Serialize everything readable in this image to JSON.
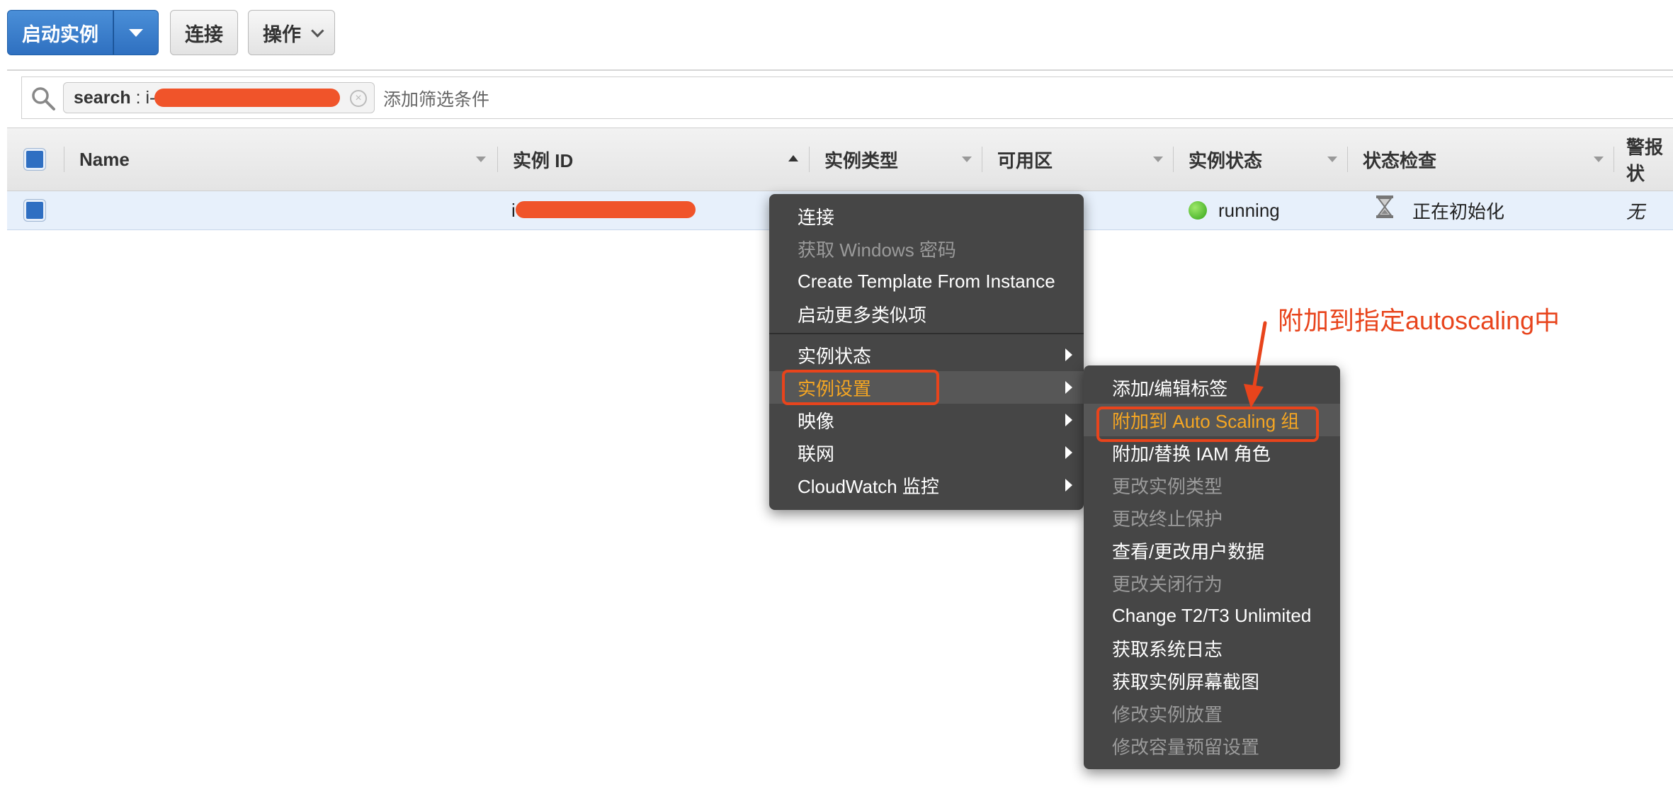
{
  "toolbar": {
    "launch_label": "启动实例",
    "connect_label": "连接",
    "actions_label": "操作"
  },
  "search": {
    "chip_key": "search",
    "chip_sep": " : ",
    "chip_value_prefix": "i-",
    "placeholder": "添加筛选条件"
  },
  "table": {
    "columns": [
      "Name",
      "实例 ID",
      "实例类型",
      "可用区",
      "实例状态",
      "状态检查",
      "警报状"
    ],
    "row": {
      "name": "",
      "instance_id_prefix": "i-",
      "state": "running",
      "status_check": "正在初始化",
      "alarm": "无"
    }
  },
  "context_menu": {
    "items": [
      {
        "label": "连接",
        "enabled": true
      },
      {
        "label": "获取 Windows 密码",
        "enabled": false
      },
      {
        "label": "Create Template From Instance",
        "enabled": true
      },
      {
        "label": "启动更多类似项",
        "enabled": true
      },
      {
        "label": "实例状态",
        "enabled": true,
        "submenu": true
      },
      {
        "label": "实例设置",
        "enabled": true,
        "submenu": true,
        "selected": true
      },
      {
        "label": "映像",
        "enabled": true,
        "submenu": true
      },
      {
        "label": "联网",
        "enabled": true,
        "submenu": true
      },
      {
        "label": "CloudWatch 监控",
        "enabled": true,
        "submenu": true
      }
    ]
  },
  "submenu": {
    "items": [
      {
        "label": "添加/编辑标签",
        "enabled": true
      },
      {
        "label": "附加到 Auto Scaling 组",
        "enabled": true,
        "selected": true
      },
      {
        "label": "附加/替换 IAM 角色",
        "enabled": true
      },
      {
        "label": "更改实例类型",
        "enabled": false
      },
      {
        "label": "更改终止保护",
        "enabled": false
      },
      {
        "label": "查看/更改用户数据",
        "enabled": true
      },
      {
        "label": "更改关闭行为",
        "enabled": false
      },
      {
        "label": "Change T2/T3 Unlimited",
        "enabled": true
      },
      {
        "label": "获取系统日志",
        "enabled": true
      },
      {
        "label": "获取实例屏幕截图",
        "enabled": true
      },
      {
        "label": "修改实例放置",
        "enabled": false
      },
      {
        "label": "修改容量预留设置",
        "enabled": false
      }
    ]
  },
  "annotation": {
    "text": "附加到指定autoscaling中",
    "color": "#e8441c"
  },
  "colors": {
    "primary": "#2f70c0",
    "menu_bg": "#464646",
    "menu_highlight_text": "#f5a623",
    "status_running": "#33a51a"
  }
}
